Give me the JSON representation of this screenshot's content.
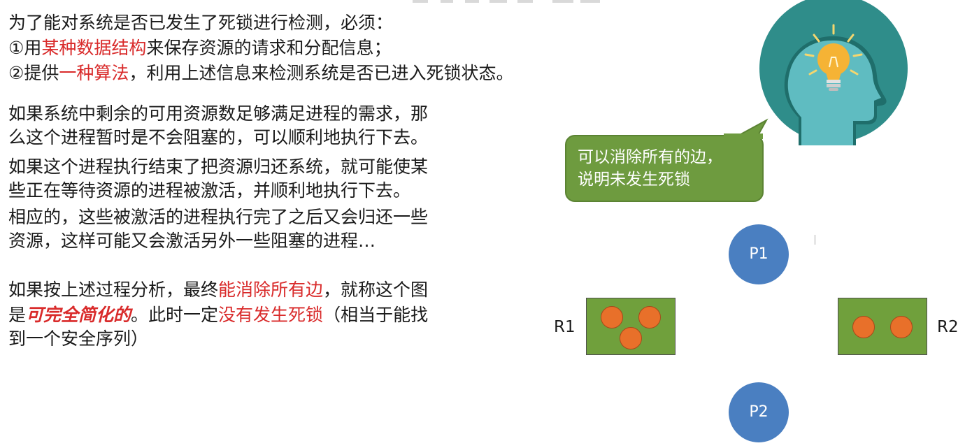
{
  "text": {
    "intro": "为了能对系统是否已发生了死锁进行检测，必须：",
    "req1_a": "①用",
    "req1_red": "某种数据结构",
    "req1_b": "来保存资源的请求和分配信息；",
    "req2_a": "②提供",
    "req2_red": "一种算法",
    "req2_b": "，利用上述信息来检测系统是否已进入死锁状态。",
    "p1_l1": "如果系统中剩余的可用资源数足够满足进程的需求，那",
    "p1_l2": "么这个进程暂时是不会阻塞的，可以顺利地执行下去。",
    "p2_l1": "如果这个进程执行结束了把资源归还系统，就可能使某",
    "p2_l2": "些正在等待资源的进程被激活，并顺利地执行下去。",
    "p3_l1": "相应的，这些被激活的进程执行完了之后又会归还一些",
    "p3_l2": "资源，这样可能又会激活另外一些阻塞的进程…",
    "c_l1_a": "如果按上述过程分析，最终",
    "c_l1_red": "能消除所有边",
    "c_l1_b": "，就称这个图",
    "c_l2_a": "是",
    "c_l2_em": "可完全简化的",
    "c_l2_b": "。此时一定",
    "c_l2_red": "没有发生死锁",
    "c_l2_c": "（相当于能找",
    "c_l3": "到一个安全序列）"
  },
  "bubble": {
    "line1": "可以消除所有的边，",
    "line2": "说明未发生死锁"
  },
  "graph": {
    "processes": [
      "P1",
      "P2"
    ],
    "resources": [
      {
        "name": "R1",
        "instances": 3
      },
      {
        "name": "R2",
        "instances": 2
      }
    ]
  },
  "colors": {
    "highlight": "#d92b2b",
    "bubble": "#6e9b3f",
    "process": "#4a7fc1",
    "resource": "#70a03c",
    "instance": "#e8702a",
    "icon_circle": "#2f8d8a",
    "bulb": "#f5b335"
  },
  "icons": [
    "head-lightbulb-icon"
  ]
}
